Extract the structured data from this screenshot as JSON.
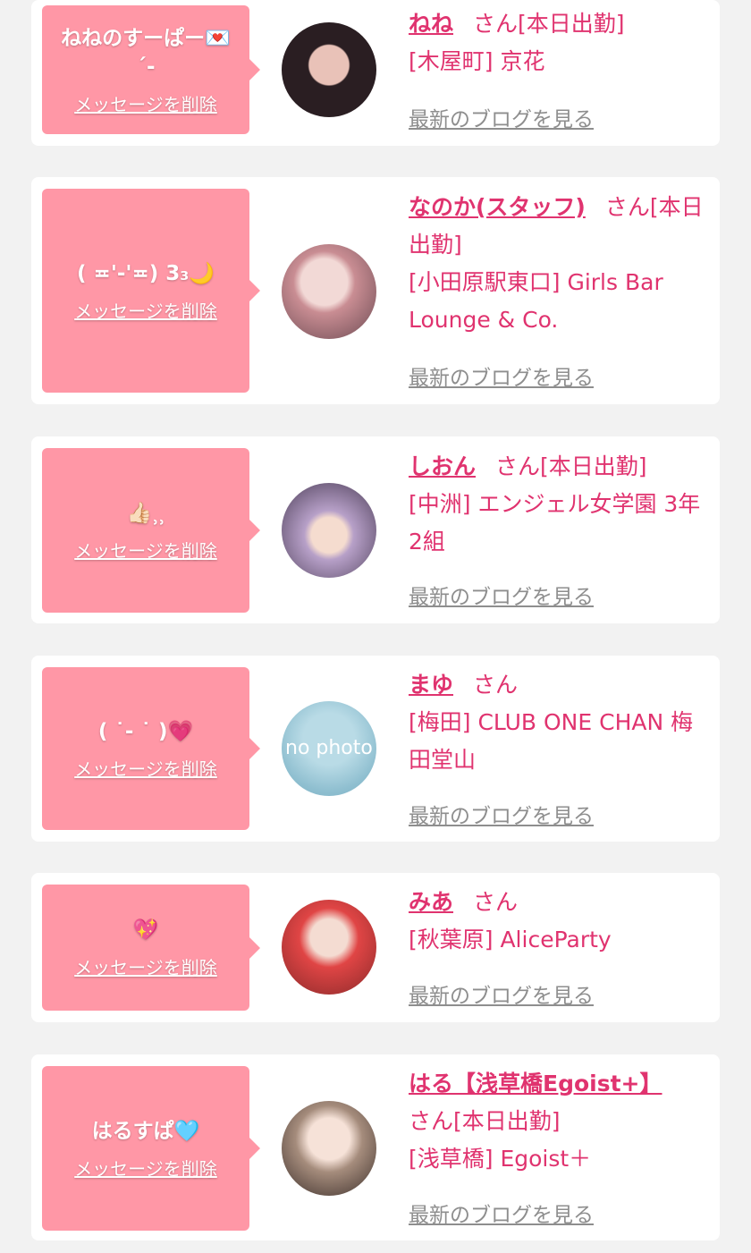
{
  "delete_label": "メッセージを削除",
  "blog_label": "最新のブログを見る",
  "honorific": "さん",
  "entries": [
    {
      "message": "ねねのすーぱー💌\n´-",
      "name": "ねね",
      "status": "[本日出勤]",
      "location": "[木屋町] 京花",
      "avatar": "avatar-photo-1"
    },
    {
      "message": "( ≖'-'≖) 3₃🌙",
      "name": "なのか(スタッフ)",
      "status": "[本日出勤]",
      "location": "[小田原駅東口] Girls Bar Lounge & Co.",
      "avatar": "avatar-photo-2"
    },
    {
      "message": "👍🏻⸒⸒",
      "name": "しおん",
      "status": "[本日出勤]",
      "location": "[中洲] エンジェル女学園 3年2組",
      "avatar": "avatar-photo-3"
    },
    {
      "message": "(  ˙- ˙  )💗",
      "name": "まゆ",
      "status": "",
      "location": "[梅田] CLUB ONE CHAN 梅田堂山",
      "avatar": "no-photo-avatar",
      "avatar_text": "no photo"
    },
    {
      "message": "💖",
      "name": "みあ",
      "status": "",
      "location": "[秋葉原] AliceParty",
      "avatar": "avatar-photo-5"
    },
    {
      "message": "はるすぱ🩵",
      "name": "はる【浅草橋Egoist+】",
      "status": "[本日出勤]",
      "location": "[浅草橋] Egoist＋",
      "avatar": "avatar-photo-6"
    }
  ]
}
